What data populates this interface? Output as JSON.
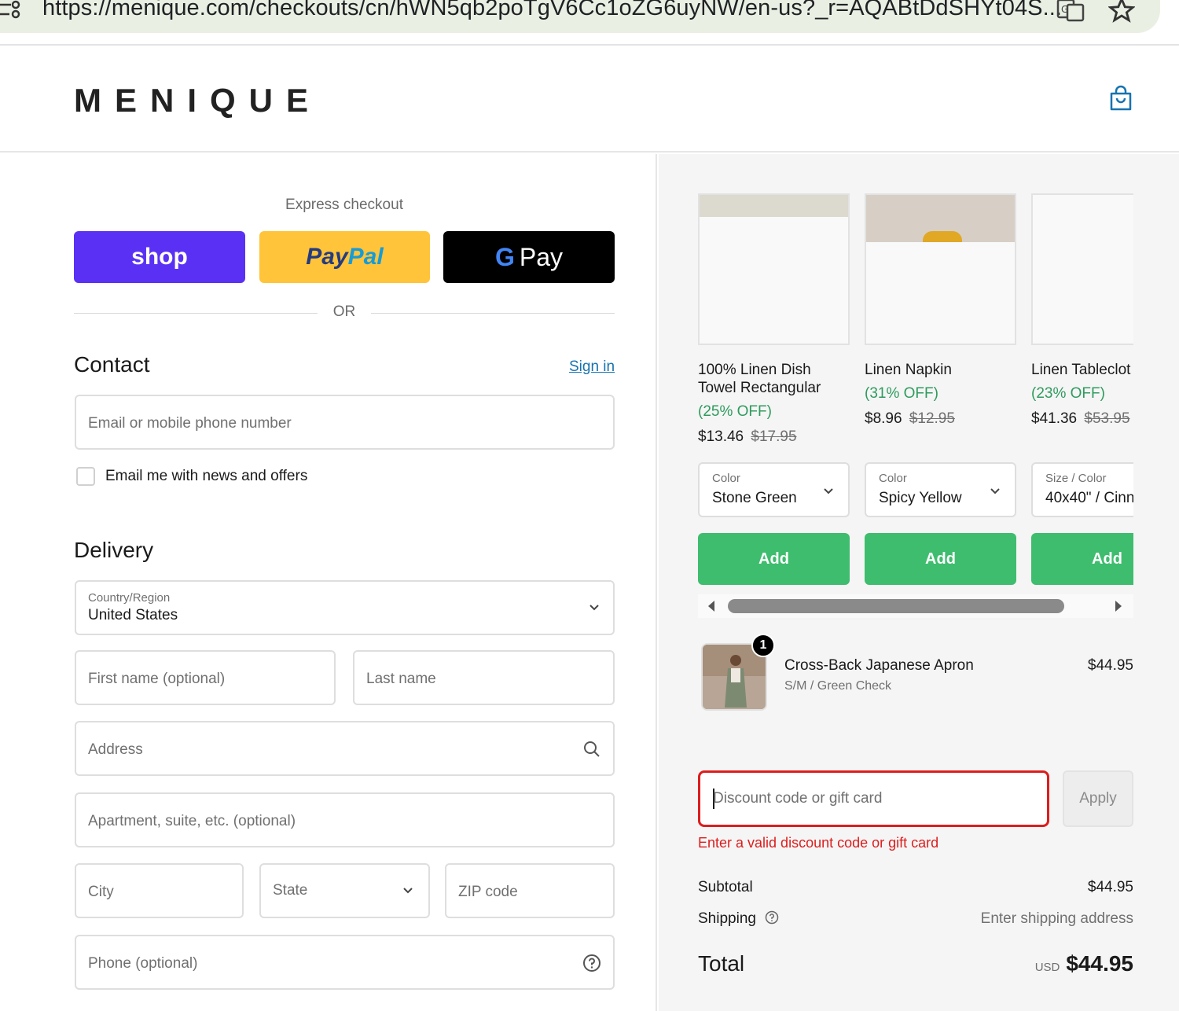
{
  "browser": {
    "url": "https://menique.com/checkouts/cn/hWN5qb2poTgV6Cc1oZG6uyNW/en-us?_r=AQABtDdSHYt04S..."
  },
  "header": {
    "logo": "MENIQUE"
  },
  "express": {
    "title": "Express checkout",
    "shop_label": "shop",
    "paypal_part1": "Pay",
    "paypal_part2": "Pal",
    "gpay_g": "G",
    "gpay_label": "Pay",
    "or_label": "OR"
  },
  "contact": {
    "title": "Contact",
    "signin": "Sign in",
    "email_placeholder": "Email or mobile phone number",
    "newsletter_label": "Email me with news and offers"
  },
  "delivery": {
    "title": "Delivery",
    "country_label": "Country/Region",
    "country_value": "United States",
    "first_name_placeholder": "First name (optional)",
    "last_name_placeholder": "Last name",
    "address_placeholder": "Address",
    "apartment_placeholder": "Apartment, suite, etc. (optional)",
    "city_placeholder": "City",
    "state_placeholder": "State",
    "zip_placeholder": "ZIP code",
    "phone_placeholder": "Phone (optional)"
  },
  "upsell": [
    {
      "name": "100% Linen Dish Towel Rectangular",
      "off": "(25% OFF)",
      "price": "$13.46",
      "compare": "$17.95",
      "option_label": "Color",
      "option_value": "Stone Green",
      "add_label": "Add"
    },
    {
      "name": "Linen Napkin",
      "off": "(31% OFF)",
      "price": "$8.96",
      "compare": "$12.95",
      "option_label": "Color",
      "option_value": "Spicy Yellow",
      "add_label": "Add"
    },
    {
      "name": "Linen Tableclot",
      "off": "(23% OFF)",
      "price": "$41.36",
      "compare": "$53.95",
      "option_label": "Size / Color",
      "option_value": "40x40\" / Cinn",
      "add_label": "Add"
    }
  ],
  "cart": {
    "item_name": "Cross-Back Japanese Apron",
    "item_variant": "S/M / Green Check",
    "item_price": "$44.95",
    "quantity": "1"
  },
  "discount": {
    "placeholder": "Discount code or gift card",
    "apply_label": "Apply",
    "error": "Enter a valid discount code or gift card"
  },
  "summary": {
    "subtotal_label": "Subtotal",
    "subtotal_value": "$44.95",
    "shipping_label": "Shipping",
    "shipping_value": "Enter shipping address",
    "total_label": "Total",
    "currency": "USD",
    "total_value": "$44.95"
  },
  "colors": {
    "shop": "#5a31f4",
    "paypal": "#ffc439",
    "add_button": "#3ebd6e",
    "error": "#dd1d1d",
    "link": "#1773b0"
  }
}
